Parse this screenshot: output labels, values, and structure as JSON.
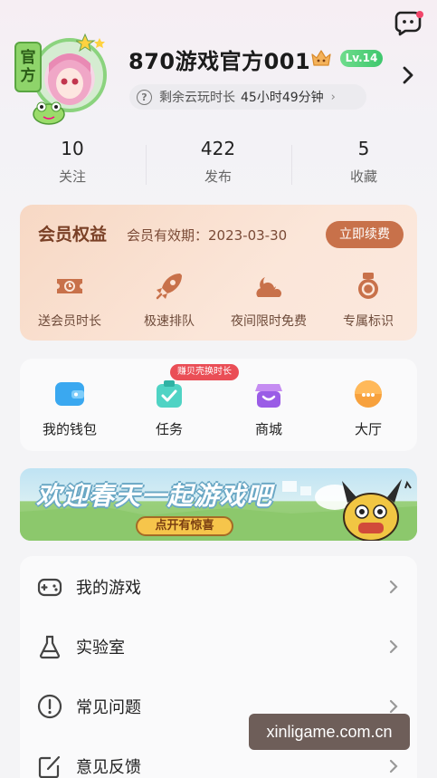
{
  "header": {
    "username": "870游戏官方001",
    "level": "Lv.14",
    "official_badge": [
      "官",
      "方"
    ],
    "cloud_time_label": "剩余云玩时长",
    "cloud_time_value": "45小时49分钟"
  },
  "stats": [
    {
      "value": "10",
      "label": "关注"
    },
    {
      "value": "422",
      "label": "发布"
    },
    {
      "value": "5",
      "label": "收藏"
    }
  ],
  "vip": {
    "title": "会员权益",
    "expiry": "会员有效期：2023-03-30",
    "renew_label": "立即续费",
    "items": [
      {
        "label": "送会员时长",
        "icon": "ticket-icon"
      },
      {
        "label": "极速排队",
        "icon": "rocket-icon"
      },
      {
        "label": "夜间限时免费",
        "icon": "cloud-moon-icon"
      },
      {
        "label": "专属标识",
        "icon": "medal-icon"
      }
    ],
    "colors": {
      "accent": "#c8714a",
      "text": "#7a4026"
    }
  },
  "tools": {
    "task_badge": "赚贝壳换时长",
    "items": [
      {
        "label": "我的钱包",
        "icon": "wallet-icon"
      },
      {
        "label": "任务",
        "icon": "task-icon"
      },
      {
        "label": "商城",
        "icon": "shop-icon"
      },
      {
        "label": "大厅",
        "icon": "lobby-icon"
      }
    ]
  },
  "banner": {
    "title": "欢迎春天一起游戏吧",
    "cta": "点开有惊喜"
  },
  "menu": [
    {
      "label": "我的游戏",
      "icon": "gamepad-icon"
    },
    {
      "label": "实验室",
      "icon": "flask-icon"
    },
    {
      "label": "常见问题",
      "icon": "info-icon"
    },
    {
      "label": "意见反馈",
      "icon": "edit-icon"
    }
  ],
  "watermark": "xinligame.com.cn"
}
